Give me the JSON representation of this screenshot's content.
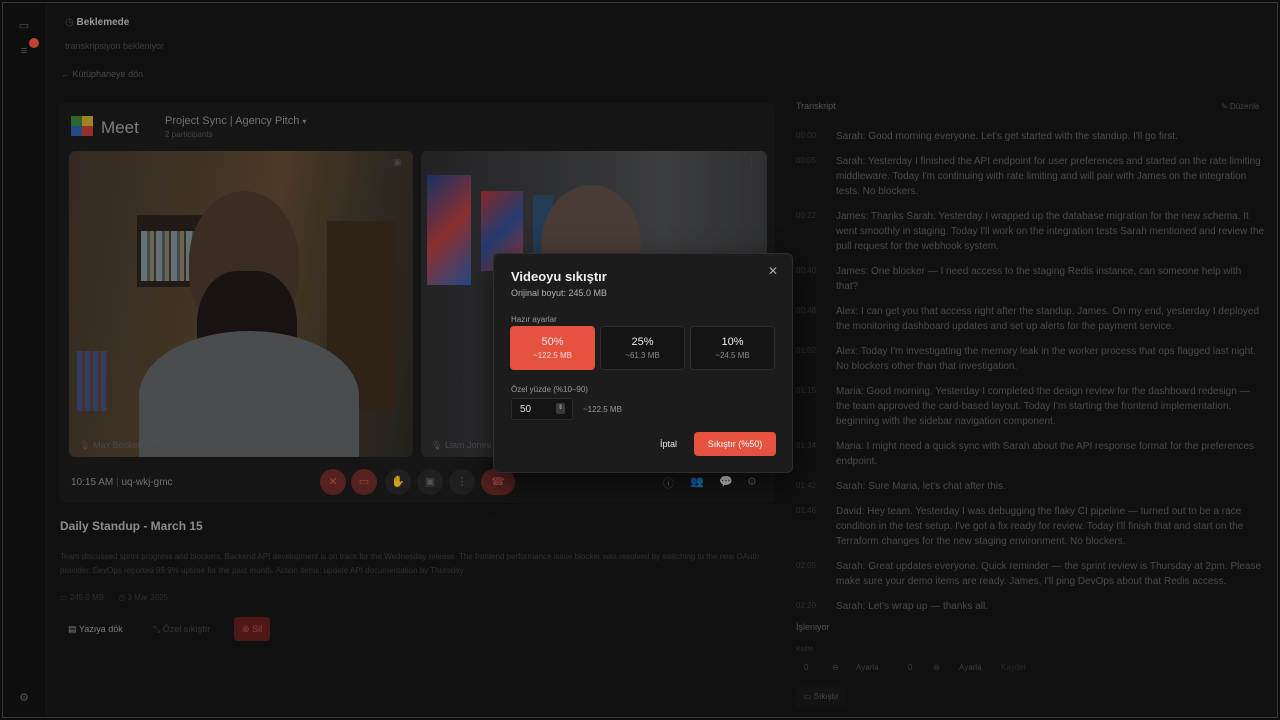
{
  "status": {
    "title": "Beklemede",
    "subtitle": "transkripsiyon bekleniyor",
    "back": "Kütüphaneye dön"
  },
  "meet": {
    "brand": "Meet",
    "title": "Project Sync | Agency Pitch",
    "participants": "2 participants",
    "participant_left": "Max Becker (You)",
    "participant_right": "Liam Jones",
    "time": "10:15 AM",
    "meeting_code": "uq-wkj-gmc"
  },
  "video_card": {
    "title": "Daily Standup - March 15",
    "description": "Team discussed sprint progress and blockers. Backend API development is on track for the Wednesday release. The frontend performance issue blocker was resolved by switching to the new OAuth provider. DevOps reported 99.9% uptime for the past month. Action items: update API documentation by Thursday.",
    "meta_size": "245.0 MB",
    "meta_date": "3 Mar 2025",
    "action_transcribe": "Yazıya dök",
    "action_custom": "Özel sıkıştır",
    "action_delete": "Sil"
  },
  "transcript": {
    "title": "Transkript",
    "edit": "Düzenle",
    "entries": [
      {
        "time": "00:00",
        "text": "Sarah: Good morning everyone. Let's get started with the standup. I'll go first."
      },
      {
        "time": "00:05",
        "text": "Sarah: Yesterday I finished the API endpoint for user preferences and started on the rate limiting middleware. Today I'm continuing with rate limiting and will pair with James on the integration tests. No blockers."
      },
      {
        "time": "00:22",
        "text": "James: Thanks Sarah. Yesterday I wrapped up the database migration for the new schema. It went smoothly in staging. Today I'll work on the integration tests Sarah mentioned and review the pull request for the webhook system."
      },
      {
        "time": "00:40",
        "text": "James: One blocker — I need access to the staging Redis instance, can someone help with that?"
      },
      {
        "time": "00:48",
        "text": "Alex: I can get you that access right after the standup, James. On my end, yesterday I deployed the monitoring dashboard updates and set up alerts for the payment service."
      },
      {
        "time": "01:02",
        "text": "Alex: Today I'm investigating the memory leak in the worker process that ops flagged last night. No blockers other than that investigation."
      },
      {
        "time": "01:15",
        "text": "Maria: Good morning. Yesterday I completed the design review for the dashboard redesign — the team approved the card-based layout. Today I'm starting the frontend implementation, beginning with the sidebar navigation component."
      },
      {
        "time": "01:34",
        "text": "Maria: I might need a quick sync with Sarah about the API response format for the preferences endpoint."
      },
      {
        "time": "01:42",
        "text": "Sarah: Sure Maria, let's chat after this."
      },
      {
        "time": "01:46",
        "text": "David: Hey team. Yesterday I was debugging the flaky CI pipeline — turned out to be a race condition in the test setup. I've got a fix ready for review. Today I'll finish that and start on the Terraform changes for the new staging environment. No blockers."
      },
      {
        "time": "02:05",
        "text": "Sarah: Great updates everyone. Quick reminder — the sprint review is Thursday at 2pm. Please make sure your demo items are ready. James, I'll ping DevOps about that Redis access."
      },
      {
        "time": "02:20",
        "text": "Sarah: Let's wrap up — thanks all."
      }
    ]
  },
  "processing": {
    "title": "İşleniyor",
    "subtitle": "Kalite",
    "value_a": "0",
    "label_a": "Ayarla",
    "value_b": "0",
    "label_b": "Ayarla",
    "label_c": "Kaydet",
    "compress": "Sıkıştır"
  },
  "modal": {
    "title": "Videoyu sıkıştır",
    "original_size": "Orijinal boyut: 245.0 MB",
    "presets_label": "Hazır ayarlar",
    "presets": [
      {
        "pct": "50%",
        "size": "~122.5 MB",
        "active": true
      },
      {
        "pct": "25%",
        "size": "~61.3 MB",
        "active": false
      },
      {
        "pct": "10%",
        "size": "~24.5 MB",
        "active": false
      }
    ],
    "custom_label": "Özel yüzde (%10–90)",
    "custom_value": "50",
    "custom_estimate": "~122.5 MB",
    "cancel": "İptal",
    "confirm": "Sıkıştır (%50)"
  },
  "colors": {
    "accent": "#e5533f",
    "modal_bg": "#1c1c1c",
    "page_bg": "#141414"
  }
}
